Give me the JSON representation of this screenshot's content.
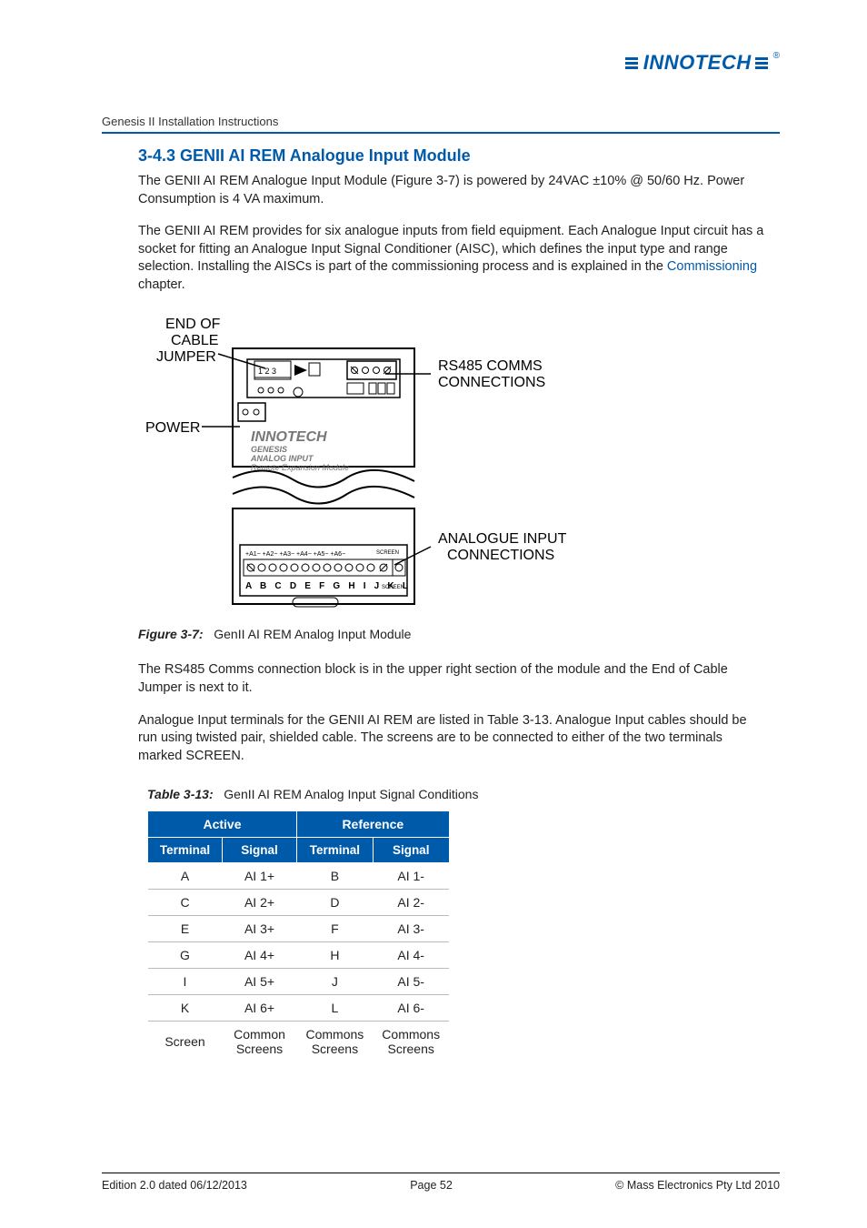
{
  "logo_text": "INNOTECH",
  "breadcrumb": "Genesis II Installation Instructions",
  "heading": "3-4.3  GENII AI REM Analogue Input Module",
  "para1": "The GENII AI REM Analogue Input Module (Figure 3-7) is powered by 24VAC ±10% @ 50/60 Hz.  Power Consumption is 4 VA maximum.",
  "para2_pre": "The GENII AI REM provides for six analogue inputs from field equipment.  Each Analogue Input circuit has a socket for fitting an Analogue Input Signal Conditioner (AISC), which defines the input type and range selection.  Installing the AISCs is part of the commissioning process and is explained in the ",
  "para2_link": "Commissioning",
  "para2_post": " chapter.",
  "fig_label": "Figure 3-7:",
  "fig_caption": "GenII AI REM Analog Input Module",
  "diagram": {
    "end_of_cable": "END OF",
    "cable": "CABLE",
    "jumper": "JUMPER",
    "power": "POWER",
    "rs485": "RS485 COMMS",
    "connections1": "CONNECTIONS",
    "analogue_input": "ANALOGUE INPUT",
    "connections2": "CONNECTIONS",
    "brand": "INNOTECH",
    "genesis": "GENESIS",
    "analog_input": "ANALOG INPUT",
    "remote": "Remote Expansion Module",
    "jumper_nums": "1 2 3",
    "terminals_top": "+A1− +A2− +A3− +A4− +A5− +A6−",
    "screen_top": "SCREEN",
    "terminals_bot": "A B C D E F G H I  J K L",
    "screen_bot": "SCREEN"
  },
  "para3": "The RS485 Comms connection block is in the upper right section of the module and the End of Cable Jumper is next to it.",
  "para4": "Analogue Input terminals for the GENII AI REM are listed in Table 3-13.  Analogue Input cables should be run using twisted pair, shielded cable.  The screens are to be connected to either of the two terminals marked SCREEN.",
  "table_label": "Table 3-13:",
  "table_caption": "GenII AI REM Analog Input Signal Conditions",
  "table": {
    "group1": "Active",
    "group2": "Reference",
    "col1": "Terminal",
    "col2": "Signal",
    "col3": "Terminal",
    "col4": "Signal",
    "rows": [
      {
        "c1": "A",
        "c2": "AI 1+",
        "c3": "B",
        "c4": "AI 1-"
      },
      {
        "c1": "C",
        "c2": "AI 2+",
        "c3": "D",
        "c4": "AI 2-"
      },
      {
        "c1": "E",
        "c2": "AI 3+",
        "c3": "F",
        "c4": "AI 3-"
      },
      {
        "c1": "G",
        "c2": "AI 4+",
        "c3": "H",
        "c4": "AI 4-"
      },
      {
        "c1": "I",
        "c2": "AI 5+",
        "c3": "J",
        "c4": "AI 5-"
      },
      {
        "c1": "K",
        "c2": "AI 6+",
        "c3": "L",
        "c4": "AI 6-"
      },
      {
        "c1": "Screen",
        "c2": "Common Screens",
        "c3": "Commons Screens",
        "c4": "Commons Screens"
      }
    ]
  },
  "footer": {
    "left": "Edition 2.0 dated 06/12/2013",
    "center": "Page 52",
    "right": "© Mass Electronics Pty Ltd  2010"
  }
}
